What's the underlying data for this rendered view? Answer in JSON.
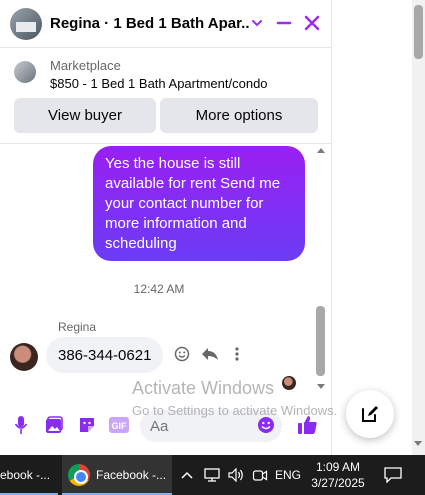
{
  "header": {
    "title": "Regina · 1 Bed 1 Bath Apar...",
    "accent": "#9b2cf0"
  },
  "marketplace": {
    "label": "Marketplace",
    "item": "$850 - 1 Bed 1 Bath Apartment/condo",
    "view_buyer": "View buyer",
    "more_options": "More options"
  },
  "messages": {
    "outgoing": "Yes the house is still available for rent Send me your contact number for more  information and scheduling",
    "timestamp": "12:42 AM",
    "sender": "Regina",
    "incoming": "386-344-0621"
  },
  "composer": {
    "placeholder": "Aa"
  },
  "watermark": {
    "line1": "Activate Windows",
    "line2": "Go to Settings to activate Windows."
  },
  "taskbar": {
    "app1": "ebook -...",
    "app2": "Facebook -...",
    "language": "ENG",
    "time": "1:09 AM",
    "date": "3/27/2025"
  }
}
